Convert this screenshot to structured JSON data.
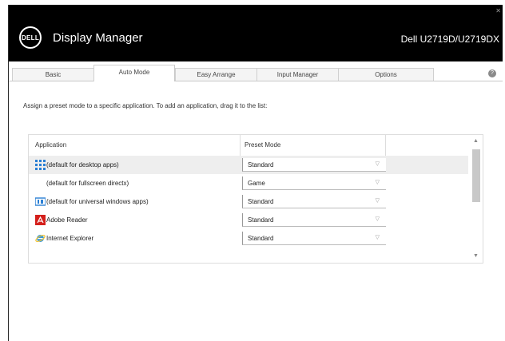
{
  "window": {
    "app_title": "Display Manager",
    "model": "Dell U2719D/U2719DX",
    "logo_text": "DELL"
  },
  "tabs": [
    {
      "label": "Basic",
      "active": false
    },
    {
      "label": "Auto Mode",
      "active": true
    },
    {
      "label": "Easy Arrange",
      "active": false
    },
    {
      "label": "Input Manager",
      "active": false
    },
    {
      "label": "Options",
      "active": false
    }
  ],
  "help_label": "?",
  "instruction": "Assign a preset mode to a specific application. To add an application, drag it to the list:",
  "list": {
    "headers": {
      "application": "Application",
      "preset_mode": "Preset Mode"
    },
    "rows": [
      {
        "icon": "desktop-apps-icon",
        "name": "(default for desktop apps)",
        "mode": "Standard"
      },
      {
        "icon": "",
        "name": "(default for fullscreen directx)",
        "mode": "Game"
      },
      {
        "icon": "universal-windows-apps-icon",
        "name": "(default for universal windows apps)",
        "mode": "Standard"
      },
      {
        "icon": "adobe-reader-icon",
        "name": "Adobe Reader",
        "mode": "Standard"
      },
      {
        "icon": "internet-explorer-icon",
        "name": "Internet Explorer",
        "mode": "Standard"
      }
    ]
  },
  "colors": {
    "titlebar": "#000000",
    "accent_blue": "#2a7fd4",
    "adobe_red": "#d4201c"
  }
}
